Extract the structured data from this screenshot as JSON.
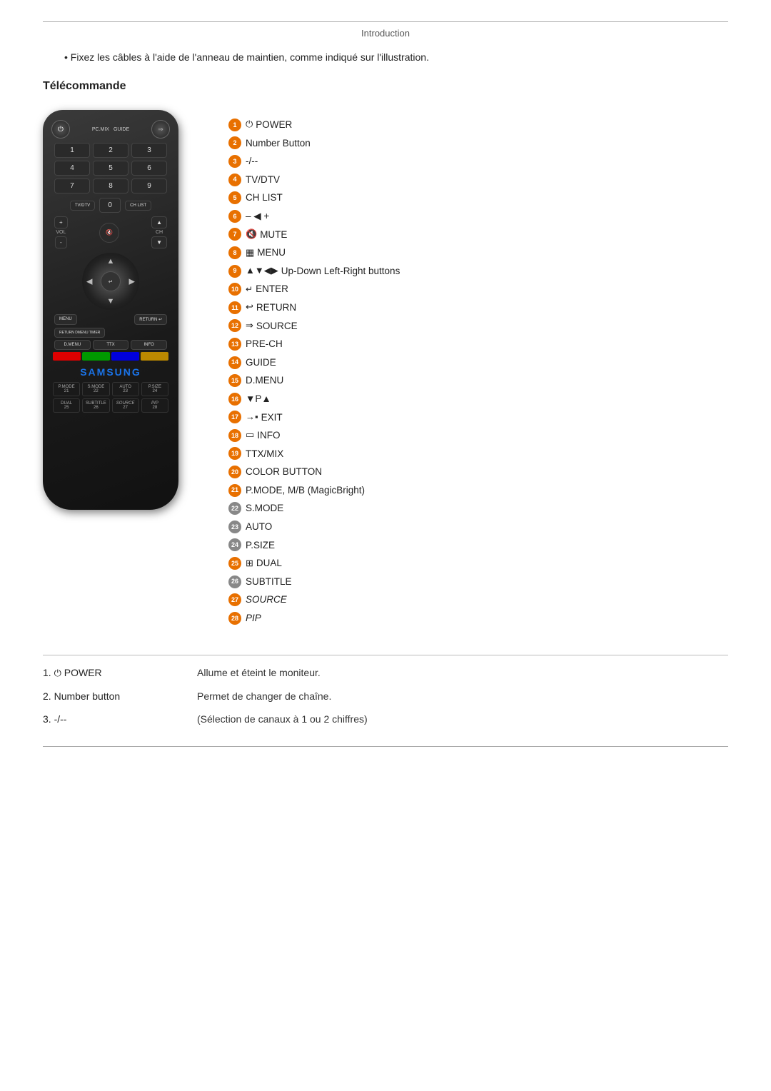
{
  "header": {
    "title": "Introduction"
  },
  "intro": {
    "bullet": "Fixez les câbles à l'aide de l'anneau de maintien, comme indiqué sur l'illustration."
  },
  "section": {
    "title": "Télécommande"
  },
  "legend": {
    "items": [
      {
        "num": "1",
        "icon": "⏻",
        "text": "POWER"
      },
      {
        "num": "2",
        "icon": "",
        "text": "Number Button"
      },
      {
        "num": "3",
        "icon": "",
        "text": "-/--"
      },
      {
        "num": "4",
        "icon": "",
        "text": "TV/DTV"
      },
      {
        "num": "5",
        "icon": "",
        "text": "CH LIST"
      },
      {
        "num": "6",
        "icon": "– ◀ +",
        "text": ""
      },
      {
        "num": "7",
        "icon": "🔇",
        "text": "MUTE"
      },
      {
        "num": "8",
        "icon": "▦",
        "text": "MENU"
      },
      {
        "num": "9",
        "icon": "▲▼◀▶",
        "text": "Up-Down Left-Right buttons"
      },
      {
        "num": "10",
        "icon": "↵",
        "text": "ENTER"
      },
      {
        "num": "11",
        "icon": "↩",
        "text": "RETURN"
      },
      {
        "num": "12",
        "icon": "⇒",
        "text": "SOURCE"
      },
      {
        "num": "13",
        "icon": "",
        "text": "PRE-CH"
      },
      {
        "num": "14",
        "icon": "",
        "text": "GUIDE"
      },
      {
        "num": "15",
        "icon": "",
        "text": "D.MENU"
      },
      {
        "num": "16",
        "icon": "▼P▲",
        "text": ""
      },
      {
        "num": "17",
        "icon": "→▪",
        "text": "EXIT"
      },
      {
        "num": "18",
        "icon": "▭",
        "text": "INFO"
      },
      {
        "num": "19",
        "icon": "",
        "text": "TTX/MIX"
      },
      {
        "num": "20",
        "icon": "",
        "text": "COLOR BUTTON"
      },
      {
        "num": "21",
        "icon": "",
        "text": "P.MODE, M/B (MagicBright)"
      },
      {
        "num": "22",
        "icon": "",
        "text": "S.MODE"
      },
      {
        "num": "23",
        "icon": "",
        "text": "AUTO"
      },
      {
        "num": "24",
        "icon": "",
        "text": "P.SIZE"
      },
      {
        "num": "25",
        "icon": "⊞",
        "text": "DUAL"
      },
      {
        "num": "26",
        "icon": "",
        "text": "SUBTITLE"
      },
      {
        "num": "27",
        "icon": "",
        "text": "SOURCE",
        "italic": true
      },
      {
        "num": "28",
        "icon": "",
        "text": "PIP",
        "italic": true
      }
    ]
  },
  "descriptions": [
    {
      "label_num": "1.",
      "label_icon": "⏻",
      "label_text": "POWER",
      "desc": "Allume et éteint le moniteur."
    },
    {
      "label_num": "2.",
      "label_icon": "",
      "label_text": "Number button",
      "desc": "Permet de changer de chaîne."
    },
    {
      "label_num": "3.",
      "label_icon": "",
      "label_text": "-/--",
      "desc": "(Sélection de canaux à 1 ou 2 chiffres)"
    }
  ]
}
